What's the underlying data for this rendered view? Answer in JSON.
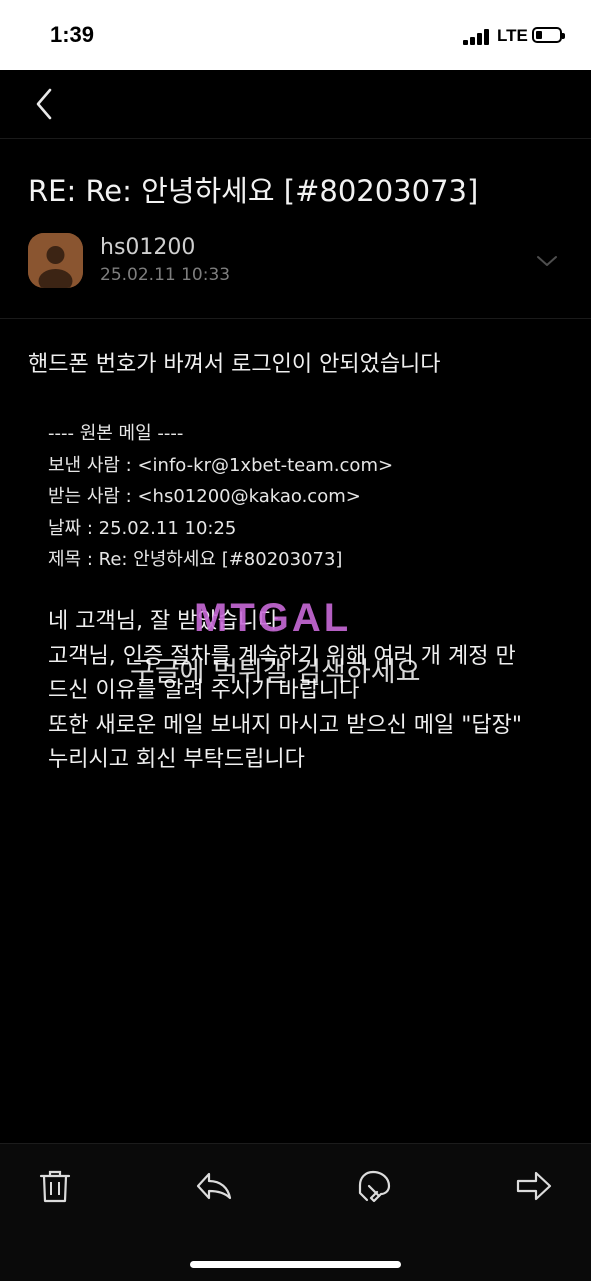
{
  "status_bar": {
    "time": "1:39",
    "network": "LTE",
    "battery_level": 0.25
  },
  "nav": {
    "back_icon": "chevron-left-icon"
  },
  "email": {
    "subject": "RE: Re: 안녕하세요 [#80203073]",
    "sender": "hs01200",
    "date": "25.02.11 10:33",
    "body_first": "핸드폰 번호가 바껴서 로그인이 안되었습니다",
    "original": {
      "header": "---- 원본 메일 ----",
      "from": "보낸 사람 : <info-kr@1xbet-team.com>",
      "to": "받는 사람 : <hs01200@kakao.com>",
      "date": "날짜 : 25.02.11 10:25",
      "subject": "제목 : Re: 안녕하세요 [#80203073]"
    },
    "reply_lines": [
      "네 고객님, 잘 받았습니다",
      "고객님, 인증 절차를 계속하기 위해 여러 개 계정 만",
      "드신 이유를 알려 주시기 바랍니다",
      "또한 새로운 메일 보내지 마시고 받으신 메일 \"답장\"",
      "누리시고 회신 부탁드립니다"
    ]
  },
  "watermark": {
    "logo": "MTGAL",
    "text": "구글에 먹튀갤 검색하세요"
  },
  "toolbar": {
    "delete_icon": "trash-icon",
    "reply_icon": "reply-icon",
    "reply_all_icon": "reply-all-icon",
    "forward_icon": "forward-icon"
  }
}
